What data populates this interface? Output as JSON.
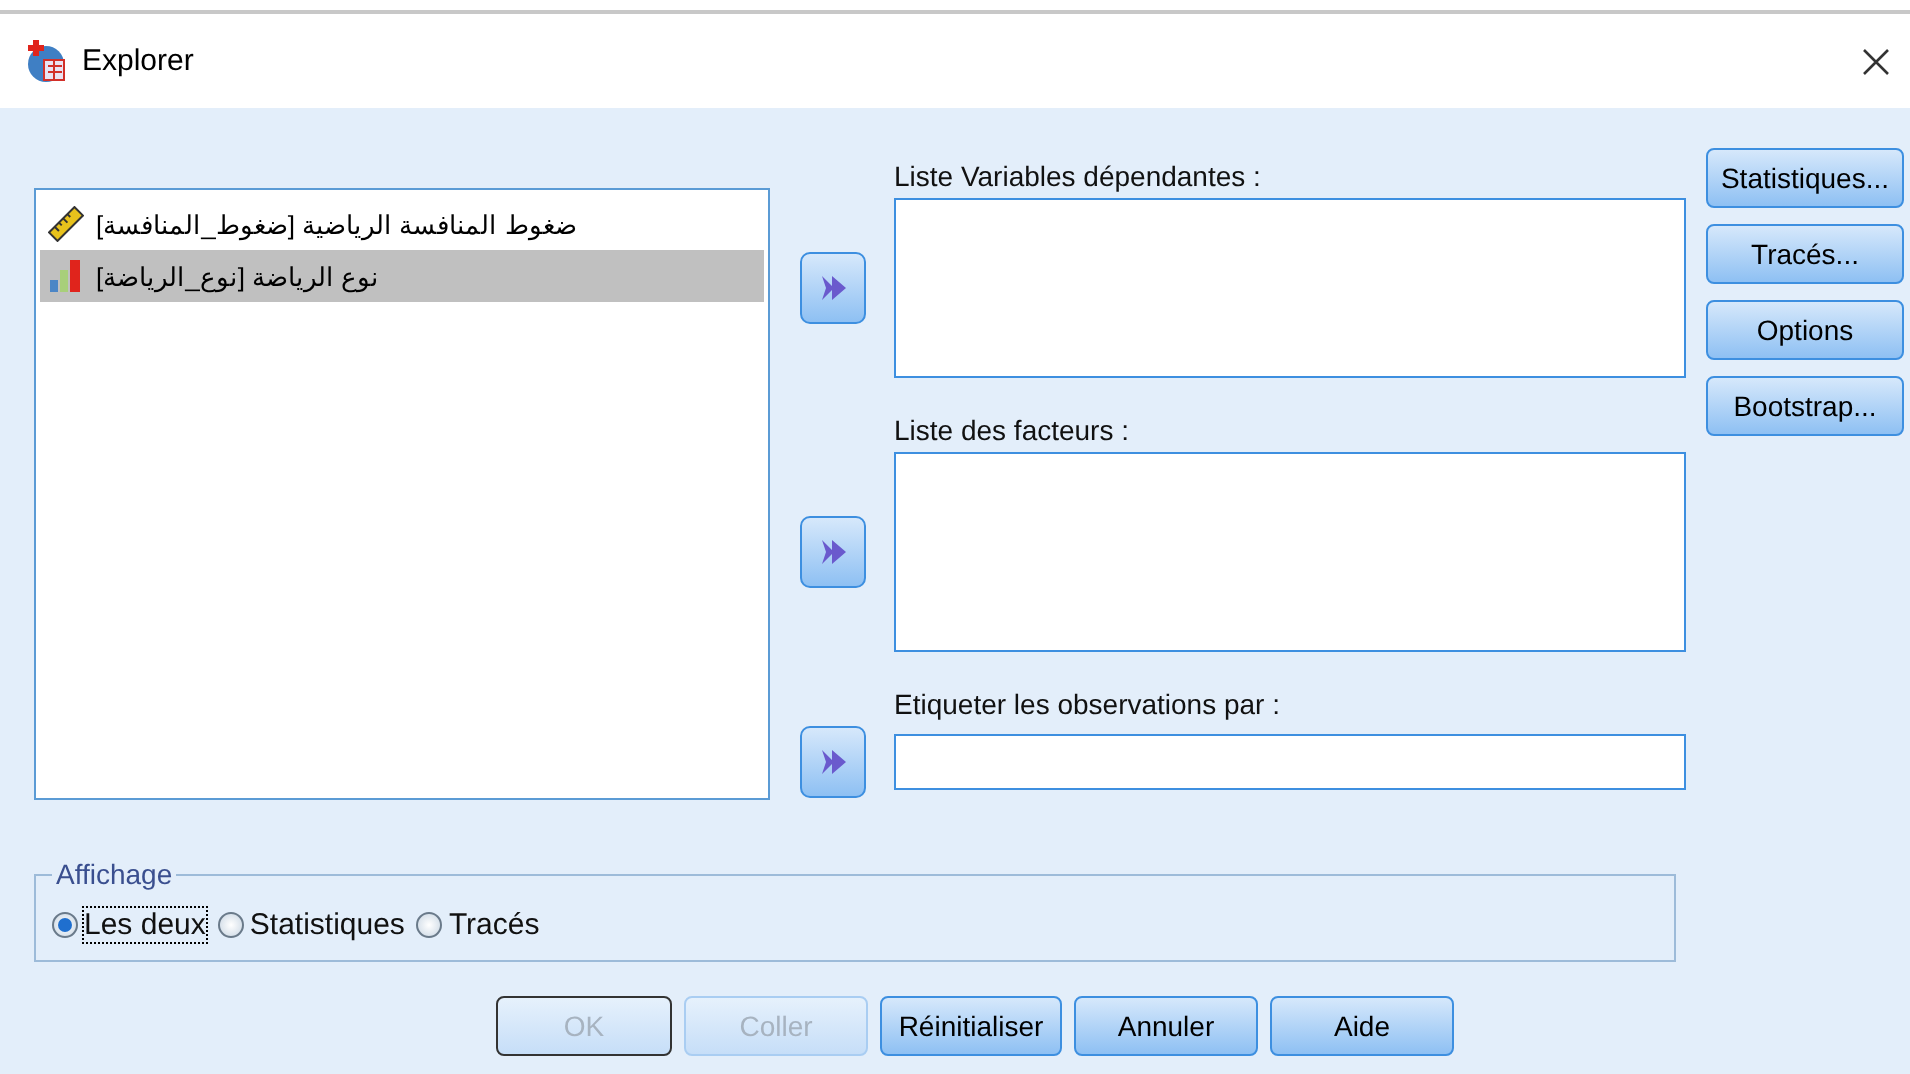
{
  "window": {
    "title": "Explorer"
  },
  "source_list": {
    "items": [
      {
        "label": "ضغوط المنافسة الرياضية [ضغوط_المنافسة]",
        "kind": "scale",
        "selected": false
      },
      {
        "label": "نوع الرياضة [نوع_الرياضة]",
        "kind": "nominal",
        "selected": true
      }
    ]
  },
  "targets": [
    {
      "label": "Liste Variables dépendantes :",
      "kind": "list"
    },
    {
      "label": "Liste des facteurs :",
      "kind": "list"
    },
    {
      "label": "Etiqueter les observations par :",
      "kind": "field"
    }
  ],
  "side_buttons": [
    "Statistiques...",
    "Tracés...",
    "Options",
    "Bootstrap..."
  ],
  "display_group": {
    "title": "Affichage",
    "options": [
      {
        "label": "Les deux",
        "selected": true
      },
      {
        "label": "Statistiques",
        "selected": false
      },
      {
        "label": "Tracés",
        "selected": false
      }
    ]
  },
  "buttons": [
    {
      "label": "OK",
      "disabled": true,
      "default": true
    },
    {
      "label": "Coller",
      "disabled": true,
      "default": false
    },
    {
      "label": "Réinitialiser",
      "disabled": false,
      "default": false
    },
    {
      "label": "Annuler",
      "disabled": false,
      "default": false
    },
    {
      "label": "Aide",
      "disabled": false,
      "default": false
    }
  ]
}
